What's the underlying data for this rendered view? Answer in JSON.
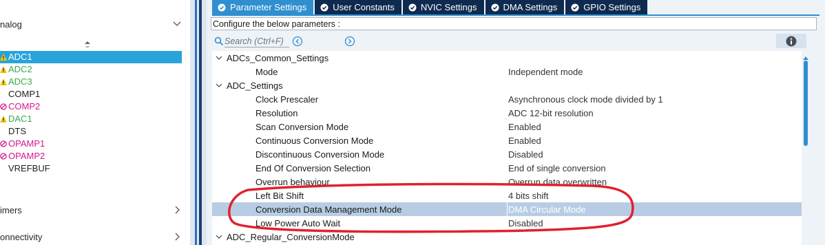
{
  "colors": {
    "accent": "#2f8fd0",
    "tab_dark": "#0f2a4f",
    "selected_row": "#2aa3db",
    "highlight_row": "#b8cde3",
    "warning_green": "#3aa84f",
    "disabled_magenta": "#d2188a",
    "annotation_red": "#e0212e"
  },
  "sidebar": {
    "categories": {
      "analog": "nalog",
      "timers": "imers",
      "connectivity": "onnectivity"
    },
    "peripherals": [
      {
        "name": "ADC1",
        "status": "warning",
        "selected": true
      },
      {
        "name": "ADC2",
        "status": "warning",
        "selected": false
      },
      {
        "name": "ADC3",
        "status": "warning",
        "selected": false
      },
      {
        "name": "COMP1",
        "status": "normal",
        "selected": false
      },
      {
        "name": "COMP2",
        "status": "disabled",
        "selected": false
      },
      {
        "name": "DAC1",
        "status": "warning",
        "selected": false
      },
      {
        "name": "DTS",
        "status": "normal",
        "selected": false
      },
      {
        "name": "OPAMP1",
        "status": "disabled",
        "selected": false
      },
      {
        "name": "OPAMP2",
        "status": "disabled",
        "selected": false
      },
      {
        "name": "VREFBUF",
        "status": "normal",
        "selected": false
      }
    ]
  },
  "tabs": [
    {
      "label": "Parameter Settings",
      "active": true
    },
    {
      "label": "User Constants",
      "active": false
    },
    {
      "label": "NVIC Settings",
      "active": false
    },
    {
      "label": "DMA Settings",
      "active": false
    },
    {
      "label": "GPIO Settings",
      "active": false
    }
  ],
  "config_label": "Configure the below parameters :",
  "search": {
    "placeholder": "Search (Ctrl+F)"
  },
  "tree": {
    "sections": [
      {
        "name": "ADCs_Common_Settings",
        "params": [
          {
            "name": "Mode",
            "value": "Independent mode"
          }
        ]
      },
      {
        "name": "ADC_Settings",
        "params": [
          {
            "name": "Clock Prescaler",
            "value": "Asynchronous clock mode divided by 1"
          },
          {
            "name": "Resolution",
            "value": "ADC 12-bit resolution"
          },
          {
            "name": "Scan Conversion Mode",
            "value": "Enabled"
          },
          {
            "name": "Continuous Conversion Mode",
            "value": "Enabled"
          },
          {
            "name": "Discontinuous Conversion Mode",
            "value": "Disabled"
          },
          {
            "name": "End Of Conversion Selection",
            "value": "End of single conversion"
          },
          {
            "name": "Overrun behaviour",
            "value": "Overrun data overwritten"
          },
          {
            "name": "Left Bit Shift",
            "value": "4 bits shift"
          },
          {
            "name": "Conversion Data Management Mode",
            "value": "DMA Circular Mode",
            "highlighted": true
          },
          {
            "name": "Low Power Auto Wait",
            "value": "Disabled"
          }
        ]
      },
      {
        "name": "ADC_Regular_ConversionMode",
        "params": []
      }
    ]
  }
}
